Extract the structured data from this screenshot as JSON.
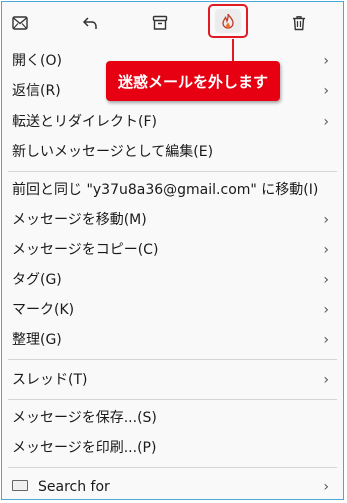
{
  "toolbar": {
    "buttons": [
      {
        "name": "mark-icon"
      },
      {
        "name": "reply-icon"
      },
      {
        "name": "archive-icon"
      },
      {
        "name": "not-junk-icon"
      },
      {
        "name": "trash-icon"
      }
    ]
  },
  "tooltip": {
    "text": "迷惑メールを外します",
    "color": "#e60012"
  },
  "menu": {
    "open": "開く(O)",
    "reply": "返信(R)",
    "forward": "転送とリダイレクト(F)",
    "new_message": "新しいメッセージとして編集(E)",
    "go_to_prev": "前回と同じ \"y37u8a36@gmail.com\" に移動(I)",
    "move": "メッセージを移動(M)",
    "copy": "メッセージをコピー(C)",
    "tag": "タグ(G)",
    "mark": "マーク(K)",
    "organize": "整理(G)",
    "thread": "スレッド(T)",
    "save": "メッセージを保存...(S)",
    "print": "メッセージを印刷...(P)",
    "search_for": "Search for"
  },
  "chevron": "›"
}
